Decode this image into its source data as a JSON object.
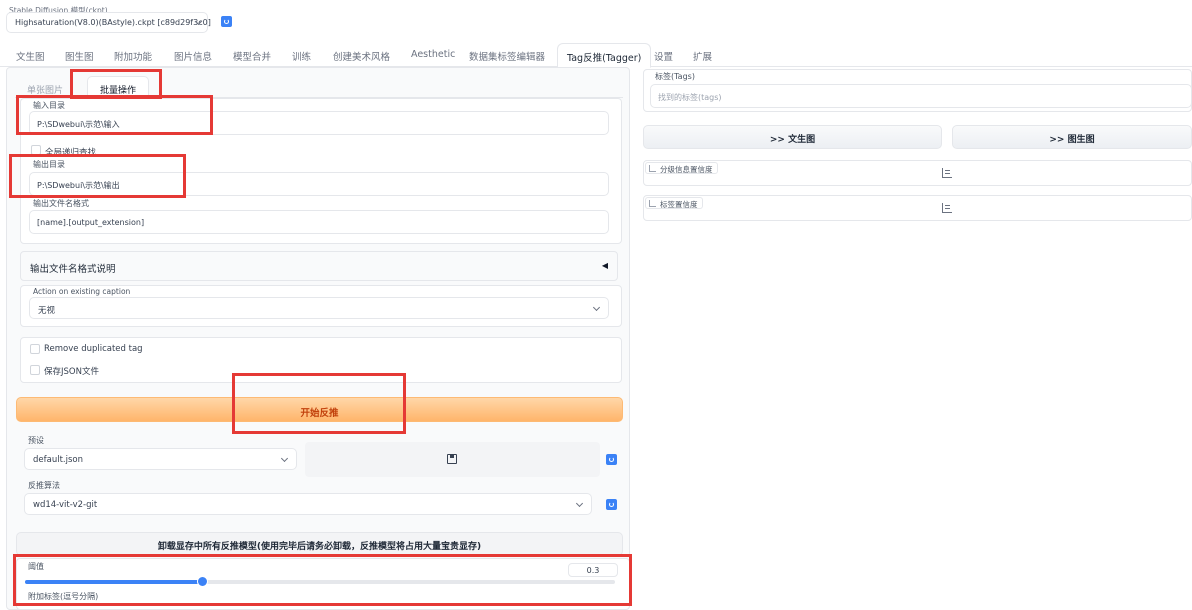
{
  "model": {
    "label": "Stable Diffusion 模型(ckpt)",
    "value": "Highsaturation(V8.0)(BAstyle).ckpt [c89d29f3c0]"
  },
  "tabs": [
    {
      "label": "文生图"
    },
    {
      "label": "图生图"
    },
    {
      "label": "附加功能"
    },
    {
      "label": "图片信息"
    },
    {
      "label": "模型合并"
    },
    {
      "label": "训练"
    },
    {
      "label": "创建美术风格"
    },
    {
      "label": "Aesthetic"
    },
    {
      "label": "数据集标签编辑器"
    },
    {
      "label": "Tag反推(Tagger)"
    },
    {
      "label": "设置"
    },
    {
      "label": "扩展"
    }
  ],
  "active_tab": "Tag反推(Tagger)",
  "subtabs": {
    "single": "单张图片",
    "batch": "批量操作"
  },
  "batch": {
    "input_dir_label": "输入目录",
    "input_dir_value": "P:\\SDwebui\\示范\\输入",
    "recursive_label": "全局递归查找",
    "output_dir_label": "输出目录",
    "output_dir_value": "P:\\SDwebui\\示范\\输出",
    "filename_format_label": "输出文件名格式",
    "filename_format_value": "[name].[output_extension]",
    "format_help_label": "输出文件名格式说明",
    "caption_action_label": "Action on existing caption",
    "caption_action_value": "无视",
    "remove_duplicated_label": "Remove duplicated tag",
    "save_json_label": "保存JSON文件"
  },
  "start_button": "开始反推",
  "preset": {
    "label": "预设",
    "value": "default.json"
  },
  "interrogator": {
    "label": "反推算法",
    "value": "wd14-vit-v2-git"
  },
  "unload_button": "卸载显存中所有反推模型(使用完毕后请务必卸载，反推模型将占用大量宝贵显存)",
  "threshold": {
    "label": "阈值",
    "value": "0.3",
    "fraction": 0.3
  },
  "additional_tags_label": "附加标签(逗号分隔)",
  "right": {
    "tags_label": "标签(Tags)",
    "tags_placeholder": "找到的标签(tags)",
    "send_txt2img": ">> 文生图",
    "send_img2img": ">> 图生图",
    "rating_label": "分级信息置信度",
    "tag_confidence_label": "标签置信度"
  },
  "colors": {
    "accent": "#3b82f6",
    "primary_button": "#ffb56b",
    "highlight": "#e53935"
  }
}
